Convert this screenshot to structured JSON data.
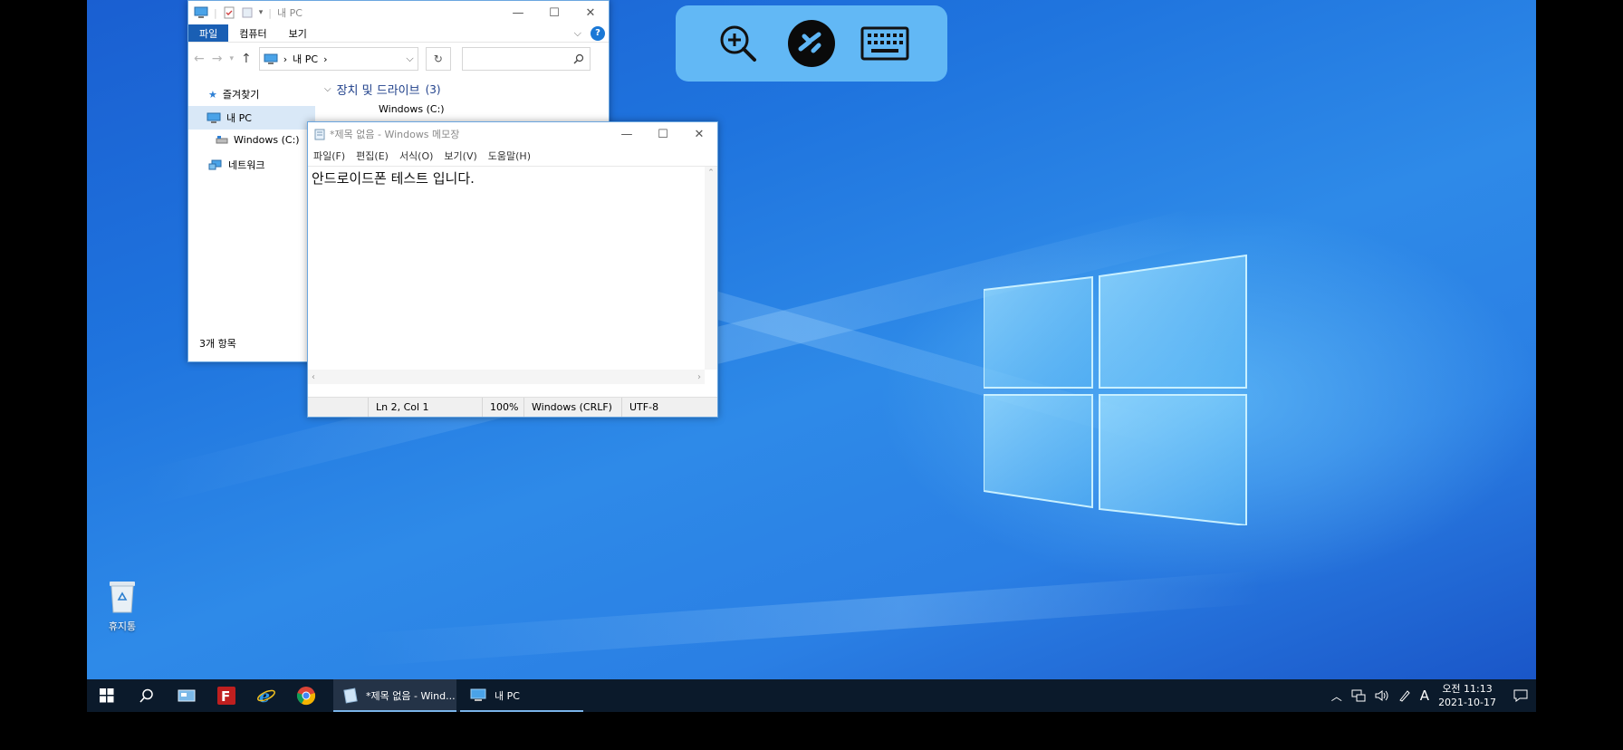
{
  "remote_toolbar": {
    "icons": [
      "zoom-in-icon",
      "remote-desktop-icon",
      "keyboard-icon"
    ]
  },
  "explorer": {
    "title": "내 PC",
    "ribbon_tabs": [
      "파일",
      "컴퓨터",
      "보기"
    ],
    "address": "내 PC",
    "nav": {
      "favorites": "즐겨찾기",
      "this_pc": "내 PC",
      "drive_c": "Windows (C:)",
      "network": "네트워크"
    },
    "group_label": "장치 및 드라이브",
    "group_count": "(3)",
    "drive_name": "Windows (C:)",
    "status": "3개 항목"
  },
  "notepad": {
    "title": "*제목 없음 - Windows 메모장",
    "menu": [
      "파일(F)",
      "편집(E)",
      "서식(O)",
      "보기(V)",
      "도움말(H)"
    ],
    "content": "안드로이드폰 테스트 입니다.",
    "status": {
      "position": "Ln 2, Col 1",
      "zoom": "100%",
      "line_ending": "Windows (CRLF)",
      "encoding": "UTF-8"
    }
  },
  "desktop": {
    "recycle_bin_label": "휴지통"
  },
  "taskbar": {
    "apps": [
      {
        "label": "*제목 없음 - Wind...",
        "icon": "notepad-icon"
      },
      {
        "label": "내 PC",
        "icon": "this-pc-icon"
      }
    ],
    "tray_ime": "A",
    "clock_time": "오전 11:13",
    "clock_date": "2021-10-17"
  }
}
